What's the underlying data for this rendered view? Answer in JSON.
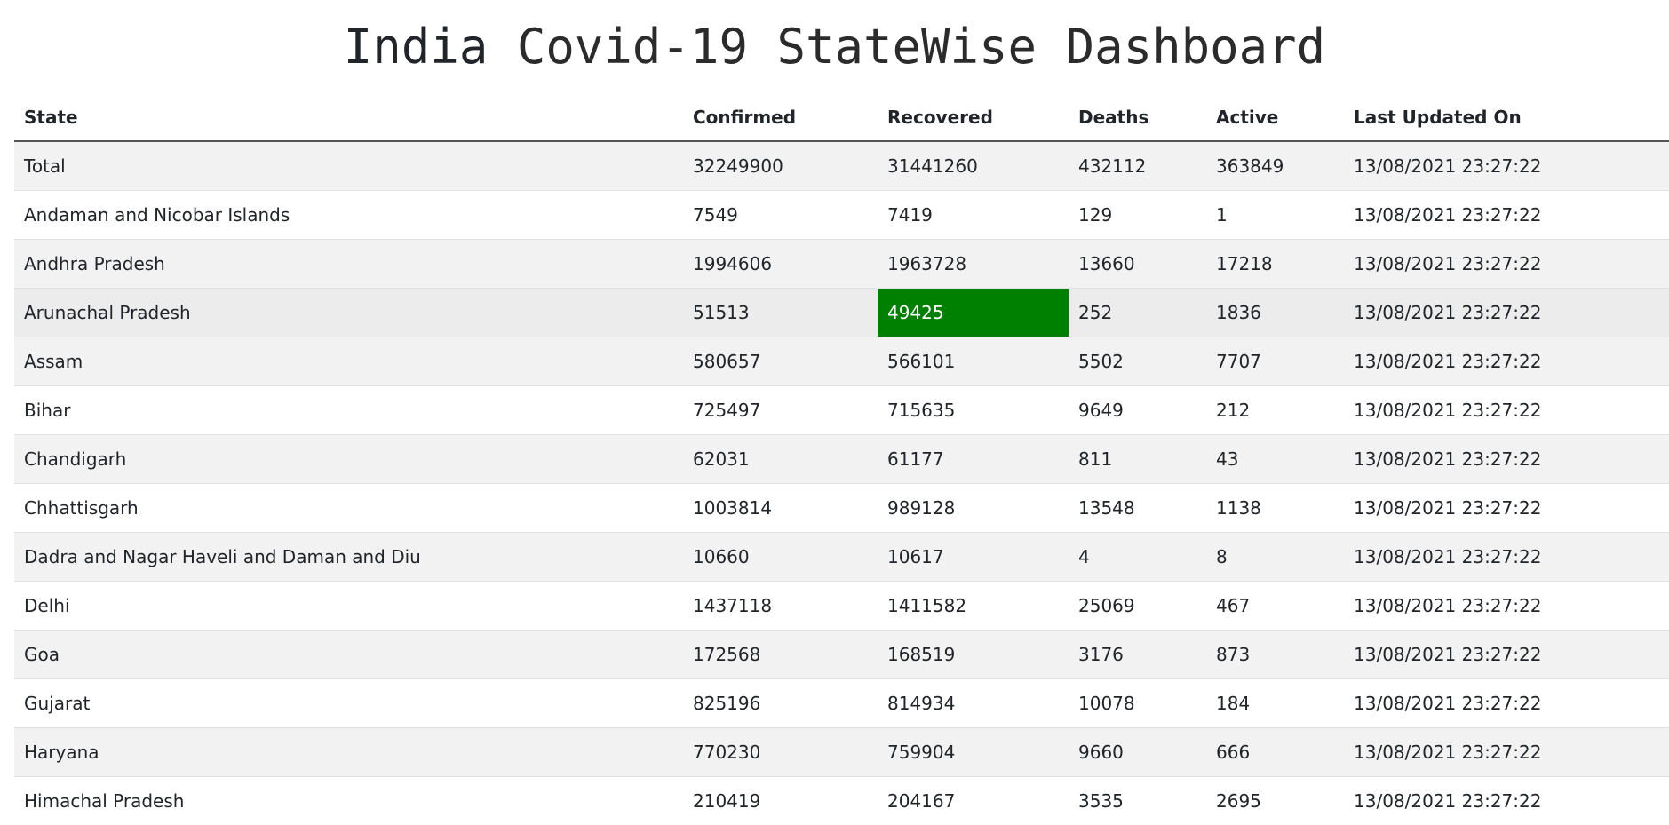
{
  "header": {
    "title_bold": "India",
    "title_light": "Covid-19 StateWise Dashboard"
  },
  "table": {
    "columns": [
      "State",
      "Confirmed",
      "Recovered",
      "Deaths",
      "Active",
      "Last Updated On"
    ],
    "rows": [
      [
        "Total",
        "32249900",
        "31441260",
        "432112",
        "363849",
        "13/08/2021 23:27:22"
      ],
      [
        "Andaman and Nicobar Islands",
        "7549",
        "7419",
        "129",
        "1",
        "13/08/2021 23:27:22"
      ],
      [
        "Andhra Pradesh",
        "1994606",
        "1963728",
        "13660",
        "17218",
        "13/08/2021 23:27:22"
      ],
      [
        "Arunachal Pradesh",
        "51513",
        "49425",
        "252",
        "1836",
        "13/08/2021 23:27:22"
      ],
      [
        "Assam",
        "580657",
        "566101",
        "5502",
        "7707",
        "13/08/2021 23:27:22"
      ],
      [
        "Bihar",
        "725497",
        "715635",
        "9649",
        "212",
        "13/08/2021 23:27:22"
      ],
      [
        "Chandigarh",
        "62031",
        "61177",
        "811",
        "43",
        "13/08/2021 23:27:22"
      ],
      [
        "Chhattisgarh",
        "1003814",
        "989128",
        "13548",
        "1138",
        "13/08/2021 23:27:22"
      ],
      [
        "Dadra and Nagar Haveli and Daman and Diu",
        "10660",
        "10617",
        "4",
        "8",
        "13/08/2021 23:27:22"
      ],
      [
        "Delhi",
        "1437118",
        "1411582",
        "25069",
        "467",
        "13/08/2021 23:27:22"
      ],
      [
        "Goa",
        "172568",
        "168519",
        "3176",
        "873",
        "13/08/2021 23:27:22"
      ],
      [
        "Gujarat",
        "825196",
        "814934",
        "10078",
        "184",
        "13/08/2021 23:27:22"
      ],
      [
        "Haryana",
        "770230",
        "759904",
        "9660",
        "666",
        "13/08/2021 23:27:22"
      ],
      [
        "Himachal Pradesh",
        "210419",
        "204167",
        "3535",
        "2695",
        "13/08/2021 23:27:22"
      ]
    ],
    "hovered_row_index": 3,
    "highlighted_cell": {
      "row": 3,
      "col": 2
    }
  },
  "colors": {
    "highlight": "#008000",
    "stripe": "#f2f2f2"
  }
}
